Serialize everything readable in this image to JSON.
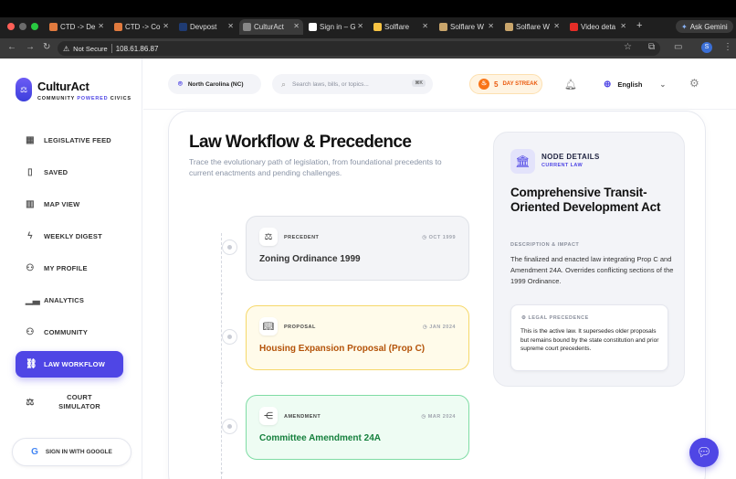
{
  "browser": {
    "tabs": [
      {
        "title": "CTD -> De",
        "icon": "pencil-icon",
        "color": "#e07a3e"
      },
      {
        "title": "CTD -> Co",
        "icon": "pencil-icon",
        "color": "#e07a3e"
      },
      {
        "title": "Devpost",
        "icon": "devpost-icon",
        "color": "#1f3b73"
      },
      {
        "title": "CulturAct",
        "icon": "globe-icon",
        "color": "#888888"
      },
      {
        "title": "Sign in – G",
        "icon": "google-icon",
        "color": "#ffffff"
      },
      {
        "title": "Solflare",
        "icon": "solflare-icon",
        "color": "#f6c343"
      },
      {
        "title": "Solflare W",
        "icon": "image-icon",
        "color": "#c9a56b"
      },
      {
        "title": "Solflare W",
        "icon": "image-icon",
        "color": "#c9a56b"
      },
      {
        "title": "Video deta",
        "icon": "youtube-icon",
        "color": "#e52d27"
      }
    ],
    "new_tab": "+",
    "gemini": "Ask Gemini",
    "security": "Not Secure",
    "url": "108.61.86.87",
    "profile_initial": "S"
  },
  "app": {
    "name": "CulturAct",
    "tagline_part1": "COMMUNITY ",
    "tagline_part2": "POWERED",
    "tagline_part3": " CIVICS"
  },
  "sidebar": {
    "items": [
      {
        "label": "LEGISLATIVE FEED",
        "icon": "grid-icon"
      },
      {
        "label": "SAVED",
        "icon": "bookmark-icon"
      },
      {
        "label": "MAP VIEW",
        "icon": "map-icon"
      },
      {
        "label": "WEEKLY DIGEST",
        "icon": "lightning-icon"
      },
      {
        "label": "MY PROFILE",
        "icon": "user-icon"
      },
      {
        "label": "ANALYTICS",
        "icon": "bar-chart-icon"
      },
      {
        "label": "COMMUNITY",
        "icon": "users-icon"
      },
      {
        "label": "LAW WORKFLOW",
        "icon": "workflow-icon"
      },
      {
        "label": "COURT SIMULATOR",
        "icon": "scales-icon"
      }
    ],
    "active": "LAW WORKFLOW",
    "google_signin": "SIGN IN WITH GOOGLE"
  },
  "header": {
    "location": "North Carolina (NC)",
    "search_placeholder": "Search laws, bills, or topics...",
    "search_shortcut": "⌘K",
    "streak_count": "5",
    "streak_label": "DAY STREAK",
    "language": "English"
  },
  "page": {
    "title": "Law Workflow & Precedence",
    "description": "Trace the evolutionary path of legislation, from foundational precedents to current enactments and pending challenges."
  },
  "timeline": [
    {
      "type": "PRECEDENT",
      "date": "OCT 1999",
      "title": "Zoning Ordinance 1999",
      "icon": "scales-icon",
      "bg": "#f3f4f7",
      "border": "#dfe2e8",
      "title_color": "#333333"
    },
    {
      "type": "PROPOSAL",
      "date": "JAN 2024",
      "title": "Housing Expansion Proposal (Prop C)",
      "icon": "book-icon",
      "bg": "#fffbea",
      "border": "#f6d86a",
      "title_color": "#b45309"
    },
    {
      "type": "AMENDMENT",
      "date": "MAR 2024",
      "title": "Committee Amendment 24A",
      "icon": "share-icon",
      "bg": "#eefcf3",
      "border": "#7fdca4",
      "title_color": "#15803d"
    }
  ],
  "node": {
    "heading": "NODE DETAILS",
    "subheading": "CURRENT LAW",
    "title": "Comprehensive Transit-Oriented Development Act",
    "desc_label": "DESCRIPTION & IMPACT",
    "description": "The finalized and enacted law integrating Prop C and Amendment 24A. Overrides conflicting sections of the 1999 Ordinance.",
    "precedence_label": "LEGAL PRECEDENCE",
    "precedence_text": "This is the active law. It supersedes older proposals but remains bound by the state constitution and prior supreme court precedents."
  }
}
